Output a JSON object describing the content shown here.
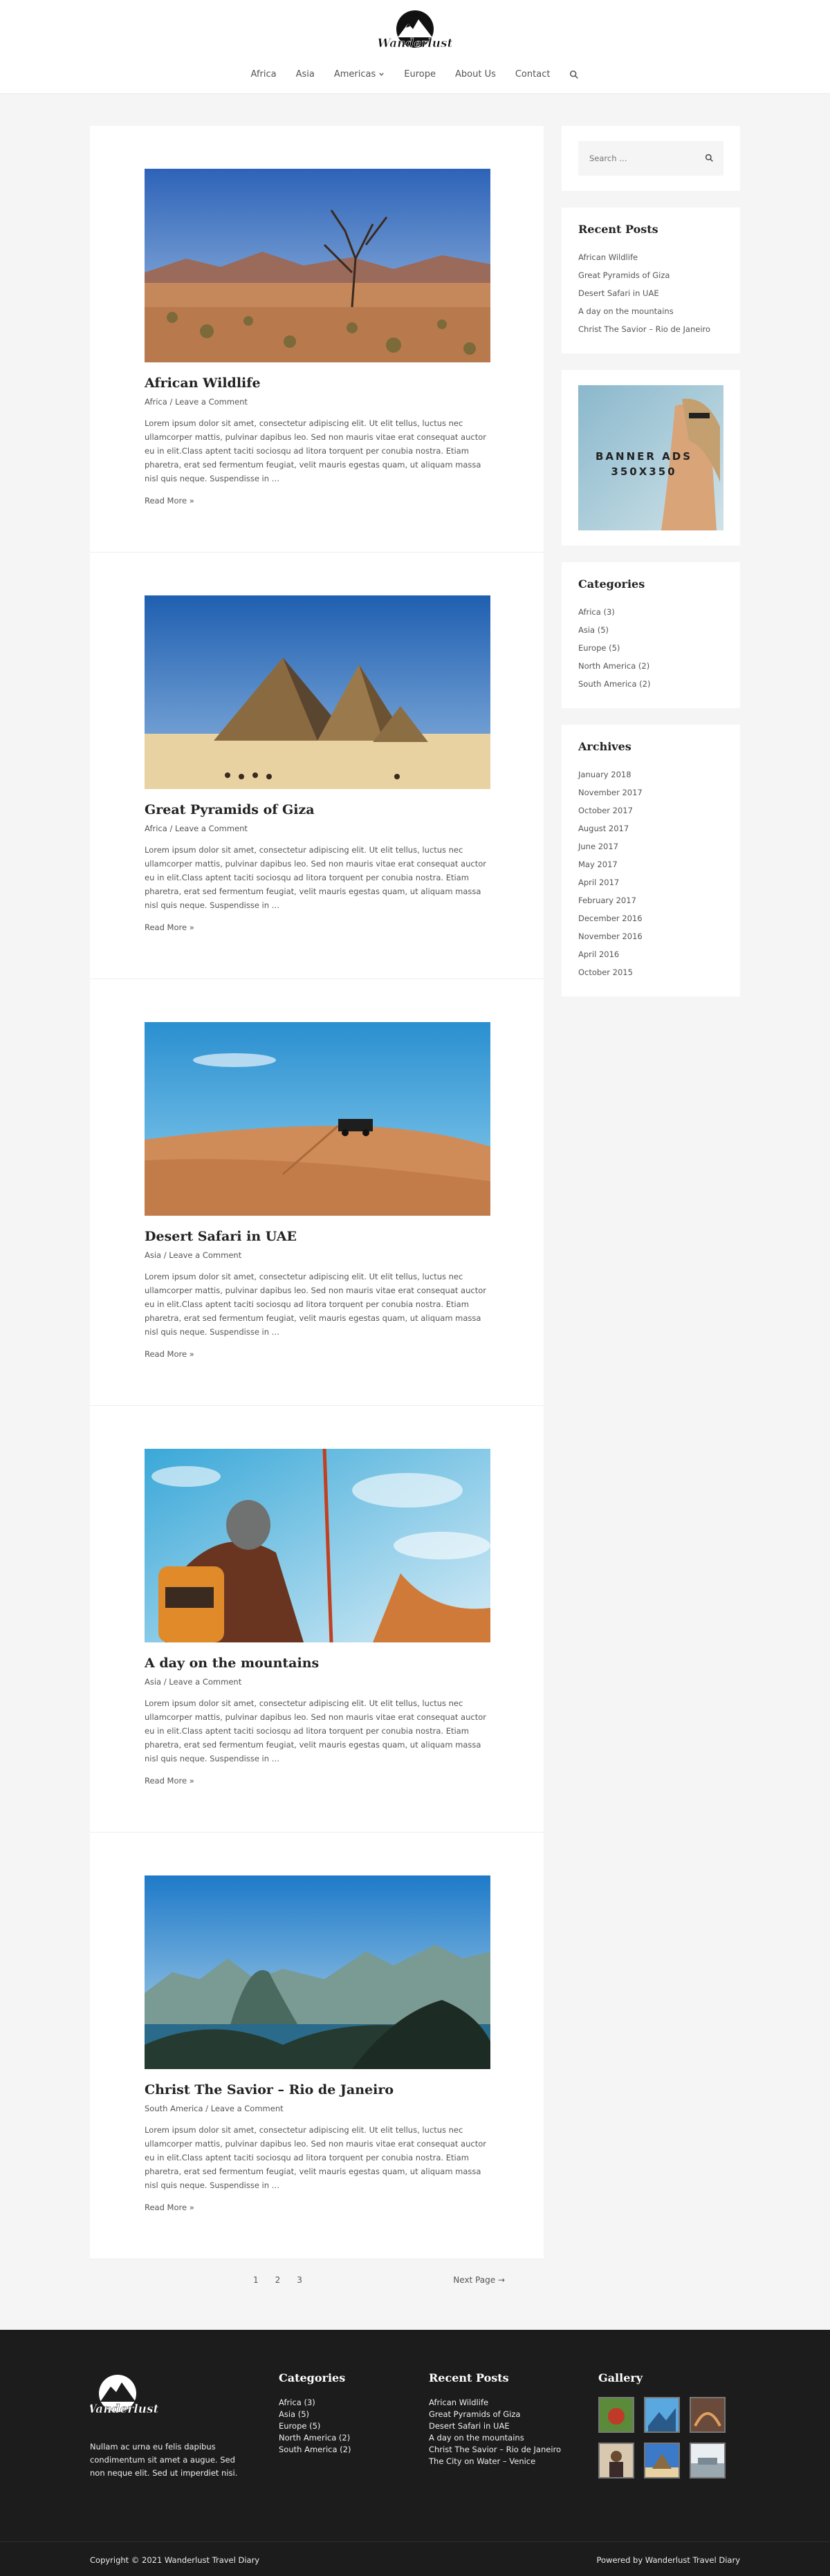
{
  "header": {
    "logo_text": "Wanderlust",
    "nav": [
      {
        "label": "Africa"
      },
      {
        "label": "Asia"
      },
      {
        "label": "Americas"
      },
      {
        "label": "Europe"
      },
      {
        "label": "About Us"
      },
      {
        "label": "Contact"
      }
    ]
  },
  "posts": [
    {
      "title": "African Wildlife",
      "category": "Africa",
      "comment": "Leave a Comment",
      "image": "desert-tree"
    },
    {
      "title": "Great Pyramids of Giza",
      "category": "Africa",
      "comment": "Leave a Comment",
      "image": "pyramids"
    },
    {
      "title": "Desert Safari in UAE",
      "category": "Asia",
      "comment": "Leave a Comment",
      "image": "desert-jeep"
    },
    {
      "title": "A day on the mountains",
      "category": "Asia",
      "comment": "Leave a Comment",
      "image": "hiker"
    },
    {
      "title": "Christ The Savior – Rio de Janeiro",
      "category": "South America",
      "comment": "Leave a Comment",
      "image": "rio"
    }
  ],
  "excerpt": "Lorem ipsum dolor sit amet, consectetur adipiscing elit. Ut elit tellus, luctus nec ullamcorper mattis, pulvinar dapibus leo. Sed non mauris vitae erat consequat auctor eu in elit.Class aptent taciti sociosqu ad litora torquent per conubia nostra. Etiam pharetra, erat sed fermentum feugiat, velit mauris egestas quam, ut aliquam massa nisl quis neque. Suspendisse in …",
  "read_more": "Read More »",
  "pagination": {
    "pages": [
      "1",
      "2",
      "3"
    ],
    "next": "Next Page →"
  },
  "sidebar": {
    "search_placeholder": "Search …",
    "recent_title": "Recent Posts",
    "recent": [
      "African Wildlife",
      "Great Pyramids of Giza",
      "Desert Safari in UAE",
      "A day on the mountains",
      "Christ The Savior – Rio de Janeiro"
    ],
    "banner_line1": "BANNER ADS",
    "banner_line2": "350X350",
    "categories_title": "Categories",
    "categories": [
      "Africa (3)",
      "Asia (5)",
      "Europe (5)",
      "North America (2)",
      "South America (2)"
    ],
    "archives_title": "Archives",
    "archives": [
      "January 2018",
      "November 2017",
      "October 2017",
      "August 2017",
      "June 2017",
      "May 2017",
      "April 2017",
      "February 2017",
      "December 2016",
      "November 2016",
      "April 2016",
      "October 2015"
    ]
  },
  "footer": {
    "about": "Nullam ac urna eu felis dapibus condimentum sit amet a augue. Sed non neque elit. Sed ut imperdiet nisi.",
    "categories_title": "Categories",
    "categories": [
      "Africa (3)",
      "Asia (5)",
      "Europe (5)",
      "North America (2)",
      "South America (2)"
    ],
    "recent_title": "Recent Posts",
    "recent": [
      "African Wildlife",
      "Great Pyramids of Giza",
      "Desert Safari in UAE",
      "A day on the mountains",
      "Christ The Savior – Rio de Janeiro",
      "The City on Water – Venice"
    ],
    "gallery_title": "Gallery",
    "copyright": "Copyright © 2021 Wanderlust Travel Diary",
    "powered": "Powered by Wanderlust Travel Diary"
  }
}
